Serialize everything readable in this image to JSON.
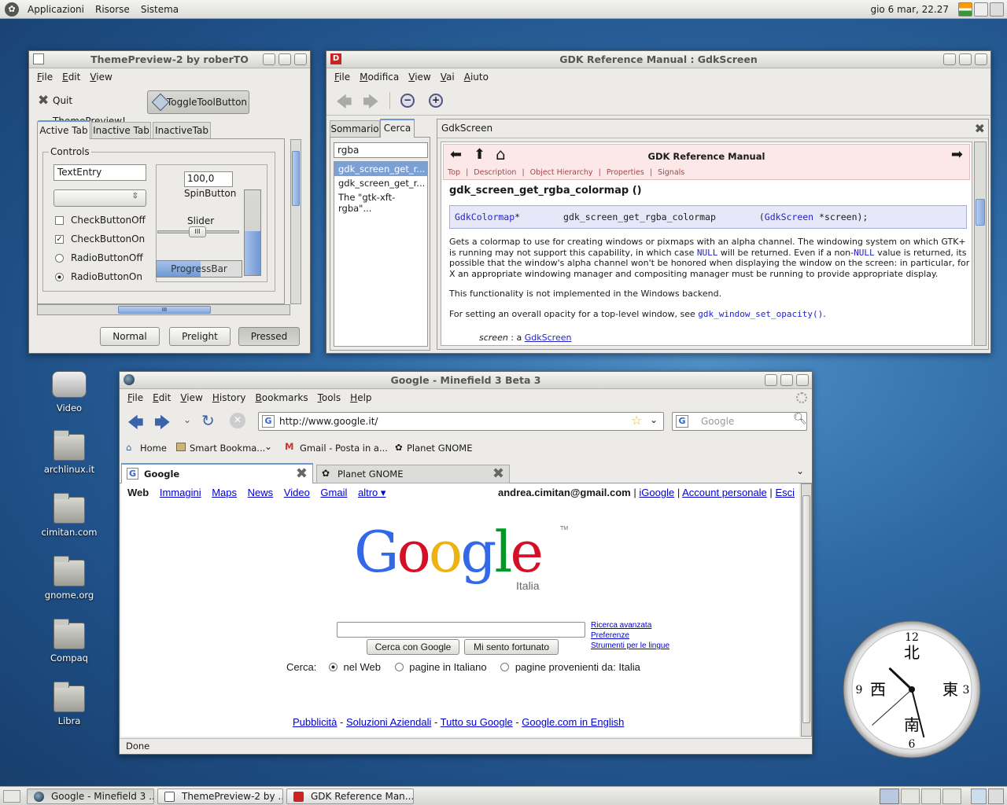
{
  "top_panel": {
    "menus": [
      "Applicazioni",
      "Risorse",
      "Sistema"
    ],
    "clock": "gio  6 mar, 22.27"
  },
  "theme_preview": {
    "title": "ThemePreview-2 by roberTO",
    "menus": [
      "File",
      "Edit",
      "View"
    ],
    "quit_label": "Quit ThemePreview!",
    "toggle_label": "ToggleToolButton",
    "tabs": [
      "Active Tab",
      "Inactive Tab",
      "InactiveTab"
    ],
    "controls_label": "Controls",
    "text_entry": "TextEntry",
    "spin_value": "100,0",
    "spin_label": "SpinButton",
    "slider_label": "Slider",
    "progress_label": "ProgressBar",
    "progress_fraction": 0.52,
    "check_off": "CheckButtonOff",
    "check_on": "CheckButtonOn",
    "radio_off": "RadioButtonOff",
    "radio_on": "RadioButtonOn",
    "scroll_glyph": "III",
    "buttons": {
      "normal": "Normal",
      "prelight": "Prelight",
      "pressed": "Pressed"
    }
  },
  "gdk": {
    "title": "GDK Reference Manual : GdkScreen",
    "menus": [
      "File",
      "Modifica",
      "View",
      "Vai",
      "Aiuto"
    ],
    "side_tabs": [
      "Sommario",
      "Cerca"
    ],
    "search_value": "rgba",
    "results": [
      "gdk_screen_get_r...",
      "gdk_screen_get_r...",
      "The \"gtk-xft-rgba\"..."
    ],
    "pane_title": "GdkScreen",
    "manual_title": "GDK Reference Manual",
    "nav_links": [
      "Top",
      "Description",
      "Object Hierarchy",
      "Properties",
      "Signals"
    ],
    "nav_sep": "|",
    "heading": "gdk_screen_get_rgba_colormap ()",
    "sig": {
      "ret_type": "GdkColormap",
      "ret_star": "*",
      "fn": "gdk_screen_get_rgba_colormap",
      "open": "(",
      "arg_type": "GdkScreen",
      "arg_rest": " *screen);"
    },
    "para1_a": "Gets a colormap to use for creating windows or pixmaps with an alpha channel. The windowing system on which GTK+ is running may not support this capability, in which case ",
    "para1_null1": "NULL",
    "para1_b": " will be returned. Even if a non-",
    "para1_null2": "NULL",
    "para1_c": " value is returned, its possible that the window's alpha channel won't be honored when displaying the window on the screen: in particular, for X an appropriate windowing manager and compositing manager must be running to provide appropriate display.",
    "para2": "This functionality is not implemented in the Windows backend.",
    "para3_a": "For setting an overall opacity for a top-level window, see ",
    "para3_link": "gdk_window_set_opacity()",
    "para3_b": ".",
    "param_name": "screen",
    "param_text": " : a ",
    "param_link": "GdkScreen"
  },
  "firefox": {
    "title": "Google - Minefield 3 Beta 3",
    "menus": [
      "File",
      "Edit",
      "View",
      "History",
      "Bookmarks",
      "Tools",
      "Help"
    ],
    "url": "http://www.google.it/",
    "search_placeholder": "Google",
    "bookmarks": [
      "Home",
      "Smart Bookma...",
      "Gmail - Posta in a...",
      "Planet GNOME"
    ],
    "tabs": [
      "Google",
      "Planet GNOME"
    ],
    "status": "Done"
  },
  "google": {
    "nav": [
      "Web",
      "Immagini",
      "Maps",
      "News",
      "Video",
      "Gmail",
      "altro ▾"
    ],
    "email": "andrea.cimitan@gmail.com",
    "sep": "|",
    "account_links": [
      "iGoogle",
      "Account personale",
      "Esci"
    ],
    "logo_sub": "Italia",
    "logo_tm": "TM",
    "search_btn": "Cerca con Google",
    "lucky_btn": "Mi sento fortunato",
    "side_links": [
      "Ricerca avanzata",
      "Preferenze",
      "Strumenti per le lingue"
    ],
    "cerca_label": "Cerca:",
    "radios": [
      "nel Web",
      "pagine in Italiano",
      "pagine provenienti da: Italia"
    ],
    "footer": [
      "Pubblicità",
      "Soluzioni Aziendali",
      "Tutto su Google",
      "Google.com in English"
    ],
    "footer_sep": " - "
  },
  "desktop_icons": [
    "Video",
    "archlinux.it",
    "cimitan.com",
    "gnome.org",
    "Compaq",
    "Libra"
  ],
  "clock_widget": {
    "n": "北",
    "s": "南",
    "e": "東",
    "w": "西",
    "twelve": "12",
    "three": "3",
    "six": "6",
    "nine": "9",
    "hour": 22,
    "minute": 27,
    "second": 38
  },
  "taskbar": [
    "Google - Minefield 3 ...",
    "ThemePreview-2 by ...",
    "GDK Reference Man..."
  ],
  "colors": {
    "google_blue": "#3369e8",
    "google_red": "#d50f25",
    "google_yellow": "#eeb211",
    "google_green": "#009925",
    "selection": "#7ba0d6"
  }
}
